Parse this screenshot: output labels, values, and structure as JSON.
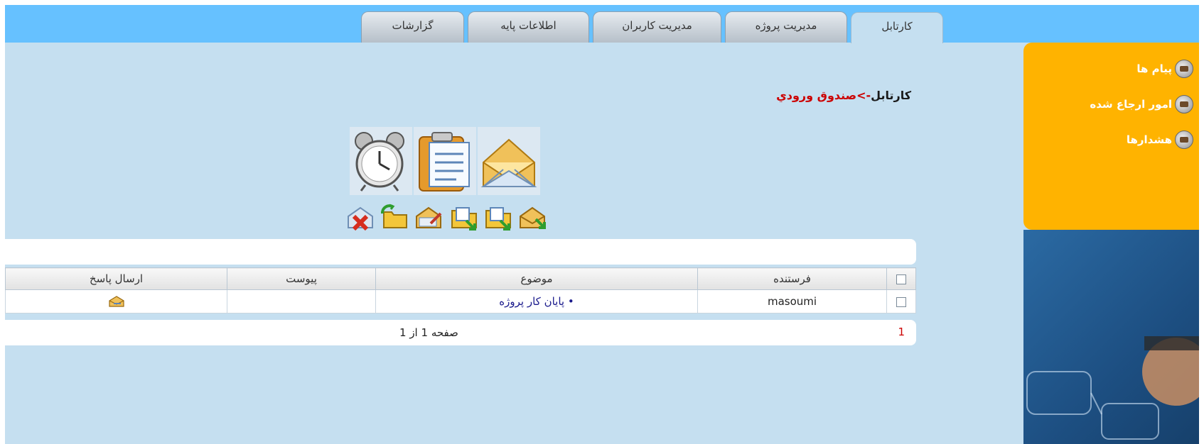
{
  "tabs": [
    {
      "label": "کارتابل",
      "active": true
    },
    {
      "label": "مدیریت پروژه",
      "active": false
    },
    {
      "label": "مدیریت کاربران",
      "active": false
    },
    {
      "label": "اطلاعات پایه",
      "active": false
    },
    {
      "label": "گزارشات",
      "active": false
    }
  ],
  "sidebar": {
    "items": [
      {
        "label": "پیام ها",
        "icon": "sidebar-bullet-icon"
      },
      {
        "label": "امور ارجاع شده",
        "icon": "sidebar-bullet-icon"
      },
      {
        "label": "هشدارها",
        "icon": "sidebar-bullet-icon"
      }
    ]
  },
  "breadcrumb": {
    "root": "کارتابل",
    "separator": "->",
    "current": "صندوق ورودي"
  },
  "toolbar": {
    "big_icons": [
      "envelope-open-icon",
      "clipboard-icon",
      "alarm-clock-icon"
    ],
    "small_icons": [
      "receive-mail-icon",
      "move-folder-icon",
      "move-folder-alt-icon",
      "edit-mail-icon",
      "refresh-folder-icon",
      "delete-mail-icon"
    ]
  },
  "table": {
    "headers": {
      "sender": "فرستنده",
      "subject": "موضوع",
      "attachment": "پیوست",
      "reply": "ارسال پاسخ"
    },
    "rows": [
      {
        "sender": "masoumi",
        "subject": "پایان کار پروژه",
        "attachment": "",
        "reply_icon": "reply-icon"
      }
    ]
  },
  "pager": {
    "current_page": "1",
    "summary": "صفحه 1 از 1"
  },
  "colors": {
    "top_bar": "#66c1ff",
    "content_bg": "#c5dff0",
    "sidebar_orange": "#ffb300",
    "link_red": "#cc0000",
    "subject_link": "#1a1a8c"
  }
}
